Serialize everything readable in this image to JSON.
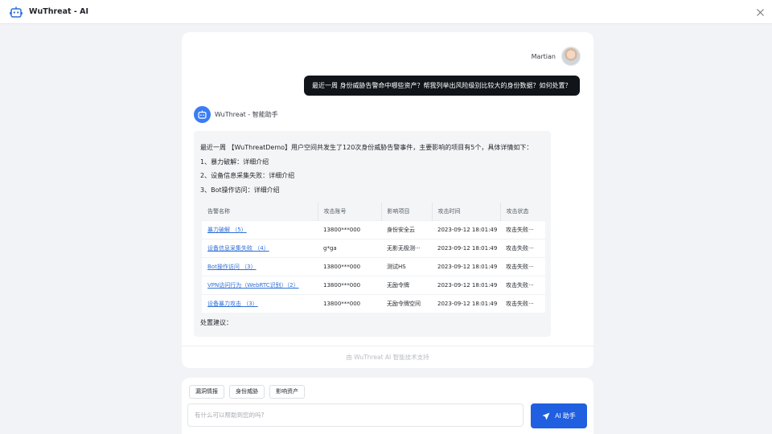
{
  "window": {
    "title": "WuThreat - AI"
  },
  "user": {
    "name": "Martian",
    "message": "最近一周 身份威胁告警命中哪些资产？帮我列举出风险级别比较大的身份数据？如何处置？"
  },
  "bot": {
    "name": "WuThreat - 智能助手",
    "intro": "最近一周 【WuThreatDemo】用户空间共发生了120次身份威胁告警事件，主要影响的项目有5个，具体详情如下：",
    "items": [
      "1、暴力破解：详细介绍",
      "2、设备信息采集失败：详细介绍",
      "3、Bot操作访问：详细介绍"
    ],
    "table": {
      "headers": [
        "告警名称",
        "攻击账号",
        "影响项目",
        "攻击时间",
        "攻击状态"
      ],
      "rows": [
        [
          "暴力破解 （5）",
          "13800***000",
          "身份安全云",
          "2023-09-12 18:01:49",
          "攻击失败···"
        ],
        [
          "设备信息采集失败 （4）",
          "g*ga",
          "无影无极测···",
          "2023-09-12 18:01:49",
          "攻击失败···"
        ],
        [
          "Bot操作访问 （3）",
          "13800***000",
          "测试HS",
          "2023-09-12 18:01:49",
          "攻击失败···"
        ],
        [
          "VPN访问行为（WebRTC识别）（2）",
          "13800***000",
          "无励令牌",
          "2023-09-12 18:01:49",
          "攻击失败···"
        ],
        [
          "设备暴力攻击 （3）",
          "13800***000",
          "无励令牌空间",
          "2023-09-12 18:01:49",
          "攻击失败···"
        ]
      ]
    },
    "suggestion": "处置建议："
  },
  "footer": {
    "text": "由 WuThreat AI 智能技术支持"
  },
  "input": {
    "tags": [
      "漏洞情报",
      "身份威胁",
      "影响资产"
    ],
    "placeholder": "有什么可以帮助到您的吗?",
    "send_label": "AI 助手"
  },
  "colors": {
    "accent": "#1f5fe0",
    "link": "#2f6fd6",
    "user_bubble": "#111418",
    "bot_avatar": "#3b7cf4"
  },
  "icons": {
    "app": "robot-icon",
    "close": "close-icon",
    "send": "send-icon"
  }
}
